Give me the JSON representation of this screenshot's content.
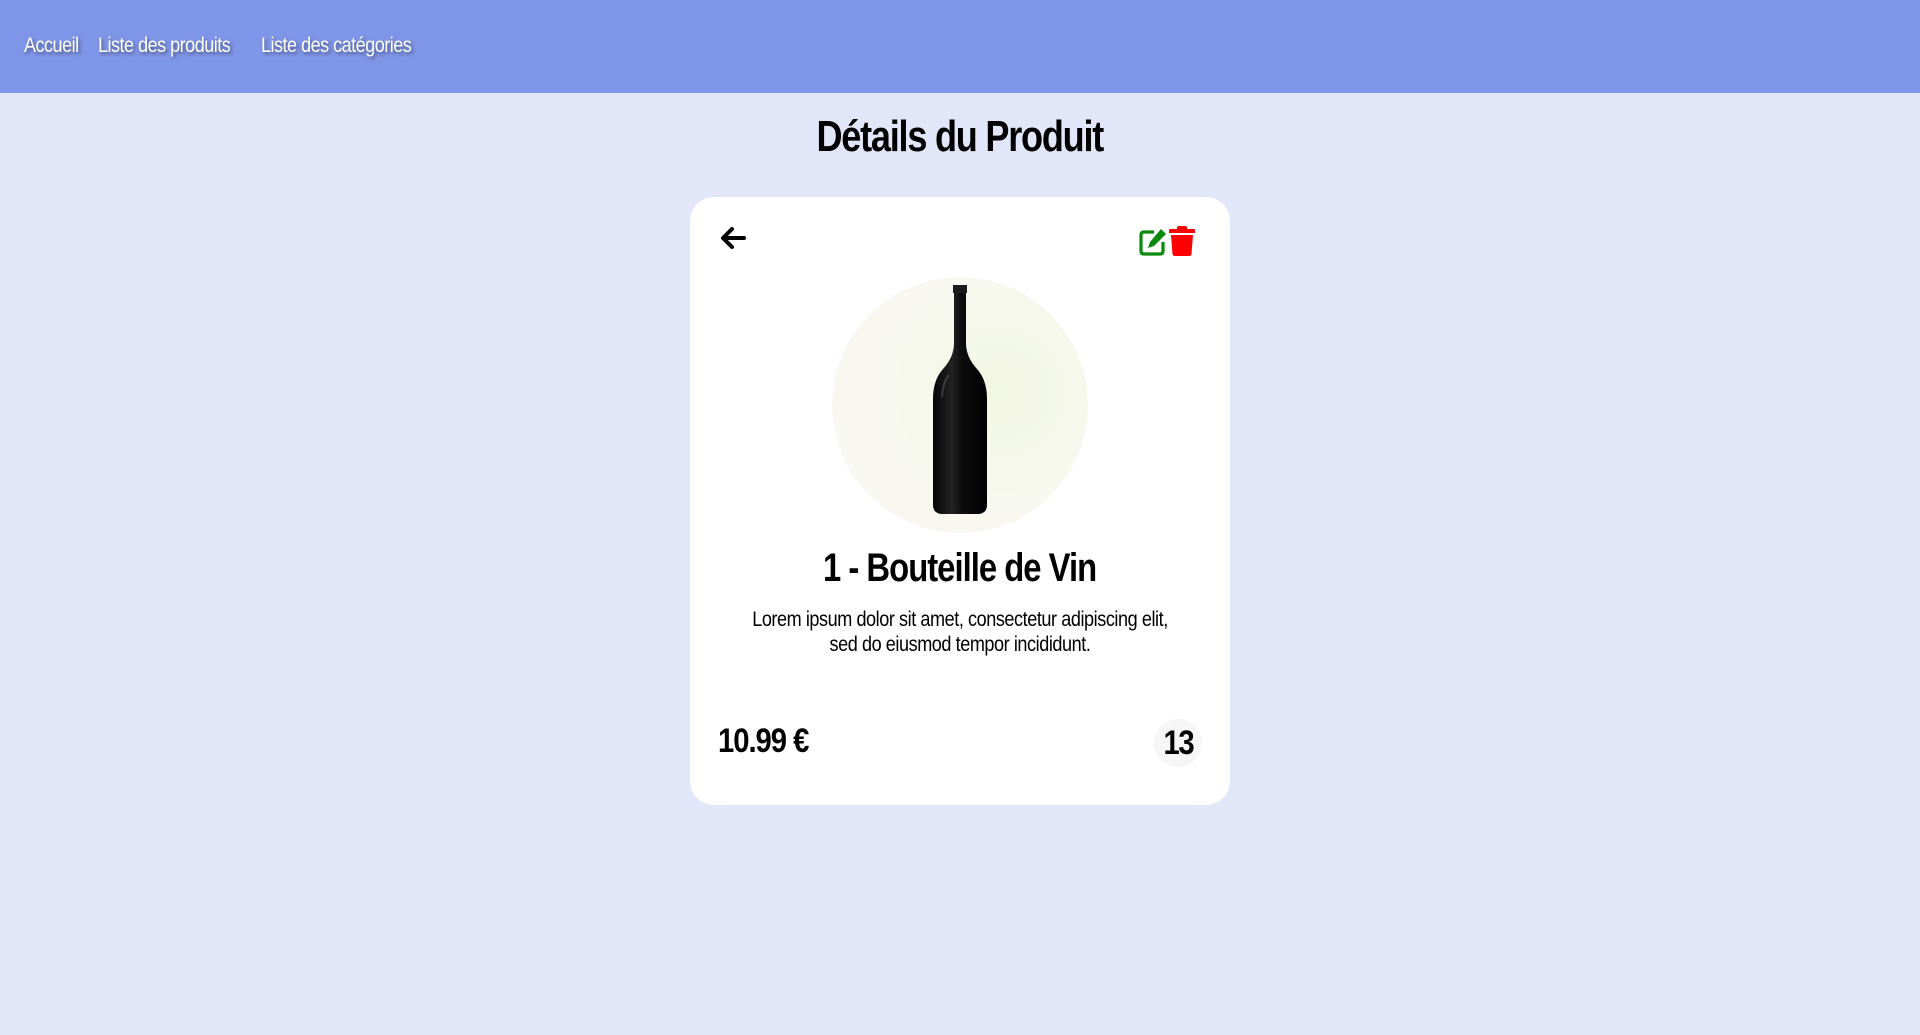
{
  "nav": {
    "items": [
      {
        "label": "Accueil"
      },
      {
        "label": "Liste des produits"
      },
      {
        "label": "Liste des catégories"
      }
    ]
  },
  "page": {
    "title": "Détails du Produit"
  },
  "product": {
    "name": "1 - Bouteille de Vin",
    "description": "Lorem ipsum dolor sit amet, consectetur adipiscing elit, sed do eiusmod tempor incididunt.",
    "price": "10.99 €",
    "quantity": "13",
    "image_icon": "wine-bottle-image"
  },
  "actions": {
    "back_icon": "arrow-left-icon",
    "edit_icon": "edit-icon",
    "delete_icon": "trash-icon",
    "edit_color": "#0a8a0a",
    "delete_color": "#ff0000"
  },
  "colors": {
    "navbar": "#7f95e8",
    "background": "#e1e6f8",
    "card": "#ffffff"
  }
}
